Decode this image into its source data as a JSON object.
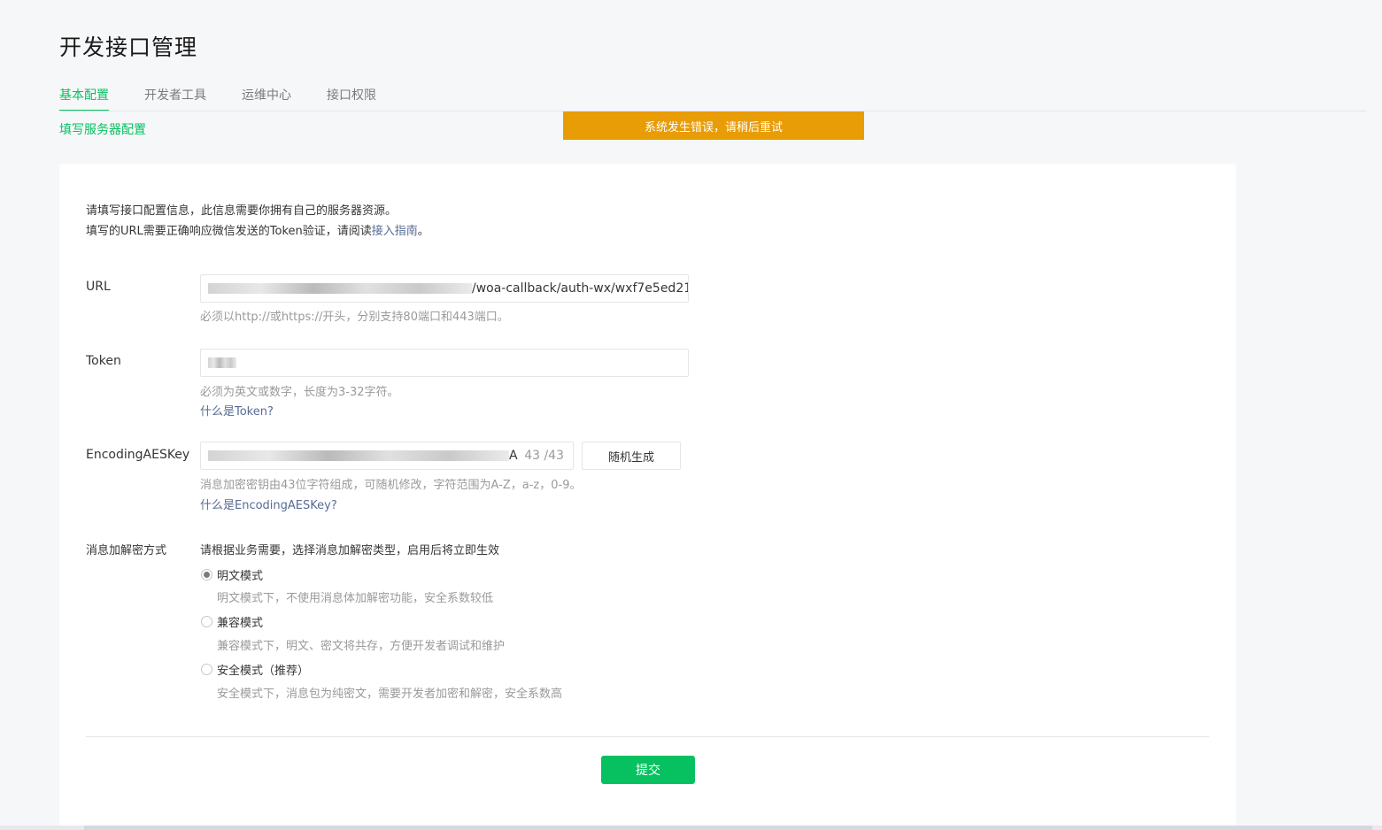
{
  "page": {
    "title": "开发接口管理"
  },
  "tabs": [
    {
      "label": "基本配置",
      "active": true
    },
    {
      "label": "开发者工具",
      "active": false
    },
    {
      "label": "运维中心",
      "active": false
    },
    {
      "label": "接口权限",
      "active": false
    }
  ],
  "subtitle": "填写服务器配置",
  "toast": {
    "text": "系统发生错误，请稍后重试",
    "color": "#e89c06"
  },
  "intro": {
    "line1": "请填写接口配置信息，此信息需要你拥有自己的服务器资源。",
    "line2_prefix": "填写的URL需要正确响应微信发送的Token验证，请阅读",
    "line2_link": "接入指南",
    "line2_suffix": "。"
  },
  "form": {
    "url": {
      "label": "URL",
      "value_visible": "/woa-callback/auth-wx/wxf7e5ed21",
      "hint": "必须以http://或https://开头，分别支持80端口和443端口。"
    },
    "token": {
      "label": "Token",
      "hint": "必须为英文或数字，长度为3-32字符。",
      "help_link": "什么是Token?"
    },
    "aes": {
      "label": "EncodingAESKey",
      "value_visible": "A",
      "count": "43 /43",
      "random_button": "随机生成",
      "hint": "消息加密密钥由43位字符组成，可随机修改，字符范围为A-Z，a-z，0-9。",
      "help_link": "什么是EncodingAESKey?"
    },
    "encryption": {
      "label": "消息加解密方式",
      "description": "请根据业务需要，选择消息加解密类型，启用后将立即生效",
      "options": [
        {
          "label": "明文模式",
          "desc": "明文模式下，不使用消息体加解密功能，安全系数较低",
          "checked": true
        },
        {
          "label": "兼容模式",
          "desc": "兼容模式下，明文、密文将共存，方便开发者调试和维护",
          "checked": false
        },
        {
          "label": "安全模式（推荐）",
          "desc": "安全模式下，消息包为纯密文，需要开发者加密和解密，安全系数高",
          "checked": false
        }
      ]
    },
    "submit": "提交"
  },
  "colors": {
    "accent": "#07c160",
    "link": "#576b95",
    "warning": "#e89c06"
  }
}
